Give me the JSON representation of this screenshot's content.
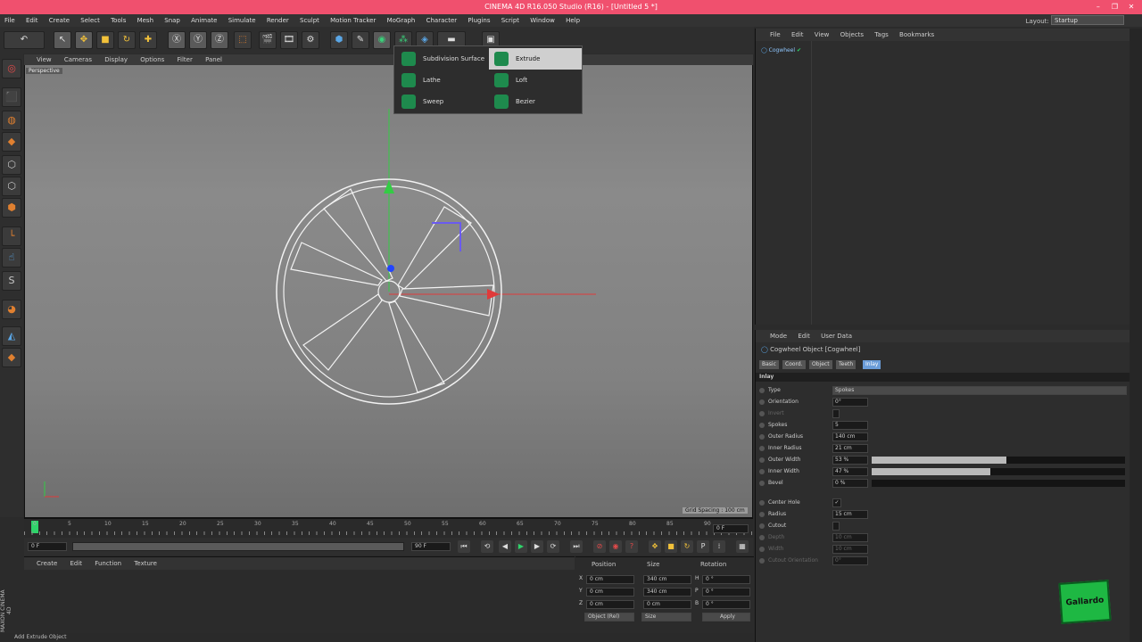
{
  "window": {
    "title": "CINEMA 4D R16.050 Studio (R16) - [Untitled 5 *]",
    "controls": [
      "–",
      "❐",
      "✕"
    ]
  },
  "menubar": {
    "items": [
      "File",
      "Edit",
      "Create",
      "Select",
      "Tools",
      "Mesh",
      "Snap",
      "Animate",
      "Simulate",
      "Render",
      "Sculpt",
      "Motion Tracker",
      "MoGraph",
      "Character",
      "Plugins",
      "Script",
      "Window",
      "Help"
    ],
    "layout_label": "Layout:",
    "layout_value": "Startup"
  },
  "viewport": {
    "menu": [
      "View",
      "Cameras",
      "Display",
      "Options",
      "Filter",
      "Panel"
    ],
    "label": "Perspective",
    "grid_spacing": "Grid Spacing : 100 cm"
  },
  "generator_popup": {
    "items": [
      {
        "label": "Subdivision Surface"
      },
      {
        "label": "Extrude",
        "highlighted": true
      },
      {
        "label": "Lathe"
      },
      {
        "label": "Loft"
      },
      {
        "label": "Sweep"
      },
      {
        "label": "Bezier"
      }
    ]
  },
  "timeline": {
    "ticks": [
      "0",
      "5",
      "10",
      "15",
      "20",
      "25",
      "30",
      "35",
      "40",
      "45",
      "50",
      "55",
      "60",
      "65",
      "70",
      "75",
      "80",
      "85",
      "90"
    ],
    "current_frame": "0 F",
    "start": "0 F",
    "end": "90 F",
    "preview_end": "90 F",
    "frame_out": "0 F"
  },
  "material_manager": {
    "menu": [
      "Create",
      "Edit",
      "Function",
      "Texture"
    ]
  },
  "coordinates": {
    "headers": [
      "Position",
      "Size",
      "Rotation"
    ],
    "rows": [
      {
        "axis": "X",
        "pos": "0 cm",
        "size": "340 cm",
        "rot_axis": "H",
        "rot": "0 °"
      },
      {
        "axis": "Y",
        "pos": "0 cm",
        "size": "340 cm",
        "rot_axis": "P",
        "rot": "0 °"
      },
      {
        "axis": "Z",
        "pos": "0 cm",
        "size": "0 cm",
        "rot_axis": "B",
        "rot": "0 °"
      }
    ],
    "mode": "Object (Rel)",
    "size_mode": "Size",
    "apply": "Apply"
  },
  "object_manager": {
    "menu": [
      "File",
      "Edit",
      "View",
      "Objects",
      "Tags",
      "Bookmarks"
    ],
    "objects": [
      {
        "name": "Cogwheel"
      }
    ]
  },
  "attribute_manager": {
    "menu": [
      "Mode",
      "Edit",
      "User Data"
    ],
    "object_title": "Cogwheel Object [Cogwheel]",
    "tabs": [
      "Basic",
      "Coord.",
      "Object",
      "Teeth",
      "Inlay"
    ],
    "active_tab": "Inlay",
    "section": "Inlay",
    "properties": [
      {
        "label": "Type",
        "value": "Spokes",
        "kind": "dropdown"
      },
      {
        "label": "Orientation",
        "value": "0°"
      },
      {
        "label": "Invert",
        "value": ""
      },
      {
        "label": "Spokes",
        "value": "5"
      },
      {
        "label": "Outer Radius",
        "value": "140 cm"
      },
      {
        "label": "Inner Radius",
        "value": "21 cm"
      },
      {
        "label": "Outer Width",
        "value": "53 %",
        "fill": 0.53
      },
      {
        "label": "Inner Width",
        "value": "47 %",
        "fill": 0.47
      },
      {
        "label": "Bevel",
        "value": "0 %",
        "fill": 0.0
      },
      {
        "label": "Center Hole",
        "value": "✓"
      },
      {
        "label": "Radius",
        "value": "15 cm"
      },
      {
        "label": "Cutout",
        "value": ""
      },
      {
        "label": "Depth",
        "value": "10 cm",
        "dim": true
      },
      {
        "label": "Width",
        "value": "10 cm",
        "dim": true
      },
      {
        "label": "Cutout Orientation",
        "value": "0°",
        "dim": true
      }
    ]
  },
  "statusbar": {
    "text": "Add Extrude Object"
  },
  "logo_text": "Gallardo"
}
